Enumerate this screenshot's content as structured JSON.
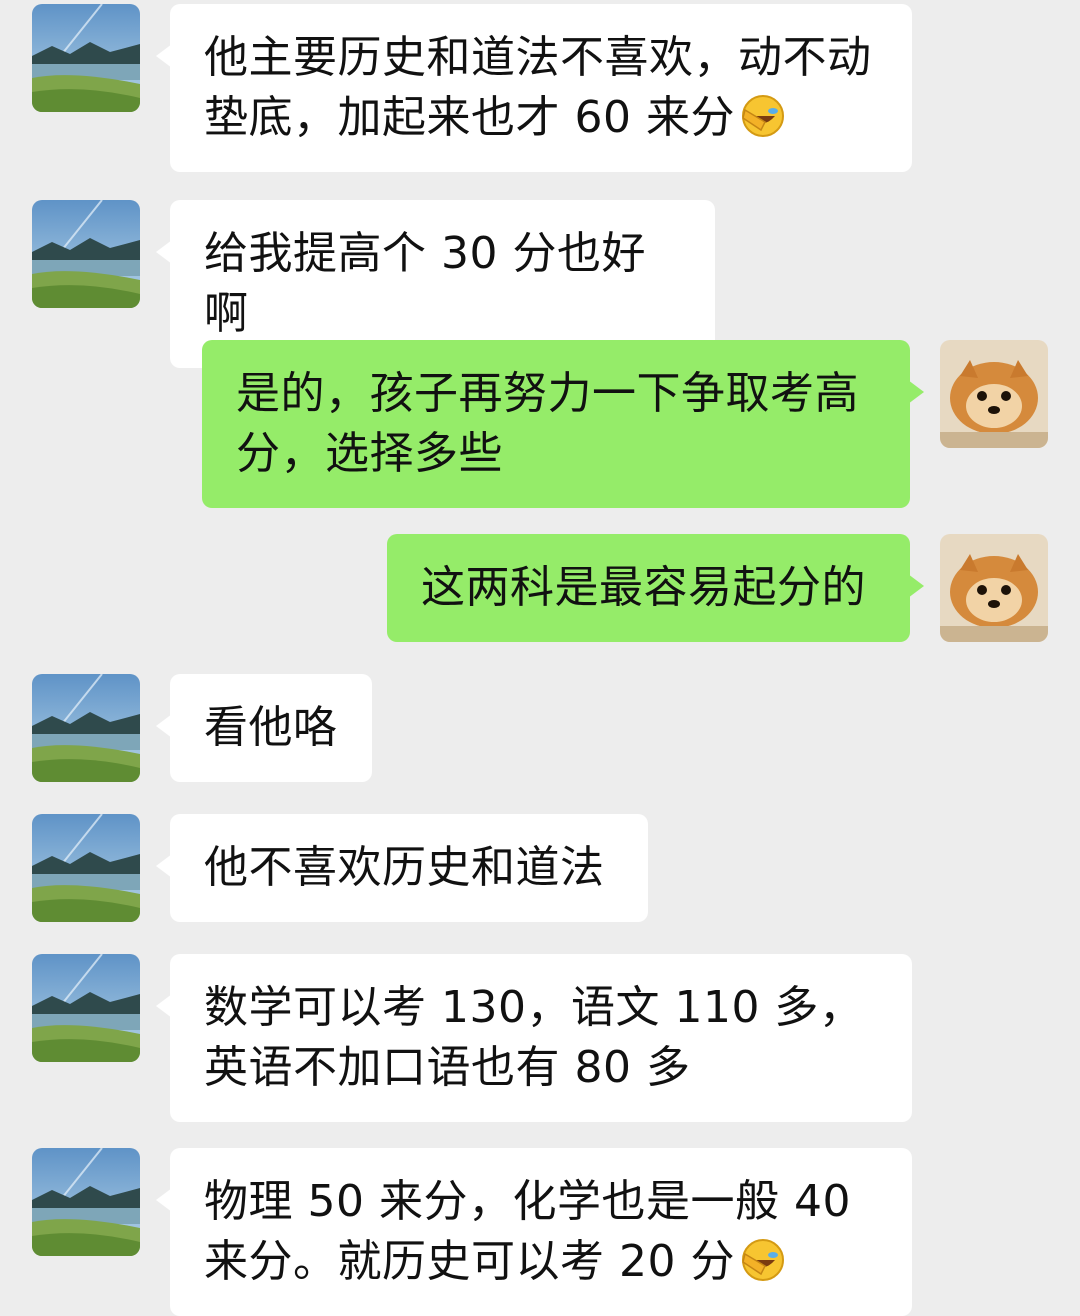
{
  "messages": [
    {
      "side": "in",
      "text": "他主要历史和道法不喜欢，动不动垫底，加起来也才 60 来分",
      "emoji": "facepalm-laugh-icon"
    },
    {
      "side": "in",
      "text": "给我提高个 30 分也好啊"
    },
    {
      "side": "out",
      "text": "是的，孩子再努力一下争取考高分，选择多些"
    },
    {
      "side": "out",
      "text": "这两科是最容易起分的"
    },
    {
      "side": "in",
      "text": "看他咯"
    },
    {
      "side": "in",
      "text": "他不喜欢历史和道法"
    },
    {
      "side": "in",
      "text": "数学可以考 130，语文 110 多，英语不加口语也有 80 多"
    },
    {
      "side": "in",
      "text": "物理 50 来分，化学也是一般 40 来分。就历史可以考 20 分",
      "emoji": "facepalm-laugh-icon"
    }
  ],
  "avatars": {
    "contact": "landscape-avatar-icon",
    "self": "pomeranian-dog-avatar-icon"
  },
  "colors": {
    "background": "#ededed",
    "incoming_bubble": "#ffffff",
    "outgoing_bubble": "#95ec69",
    "text": "#111111"
  }
}
